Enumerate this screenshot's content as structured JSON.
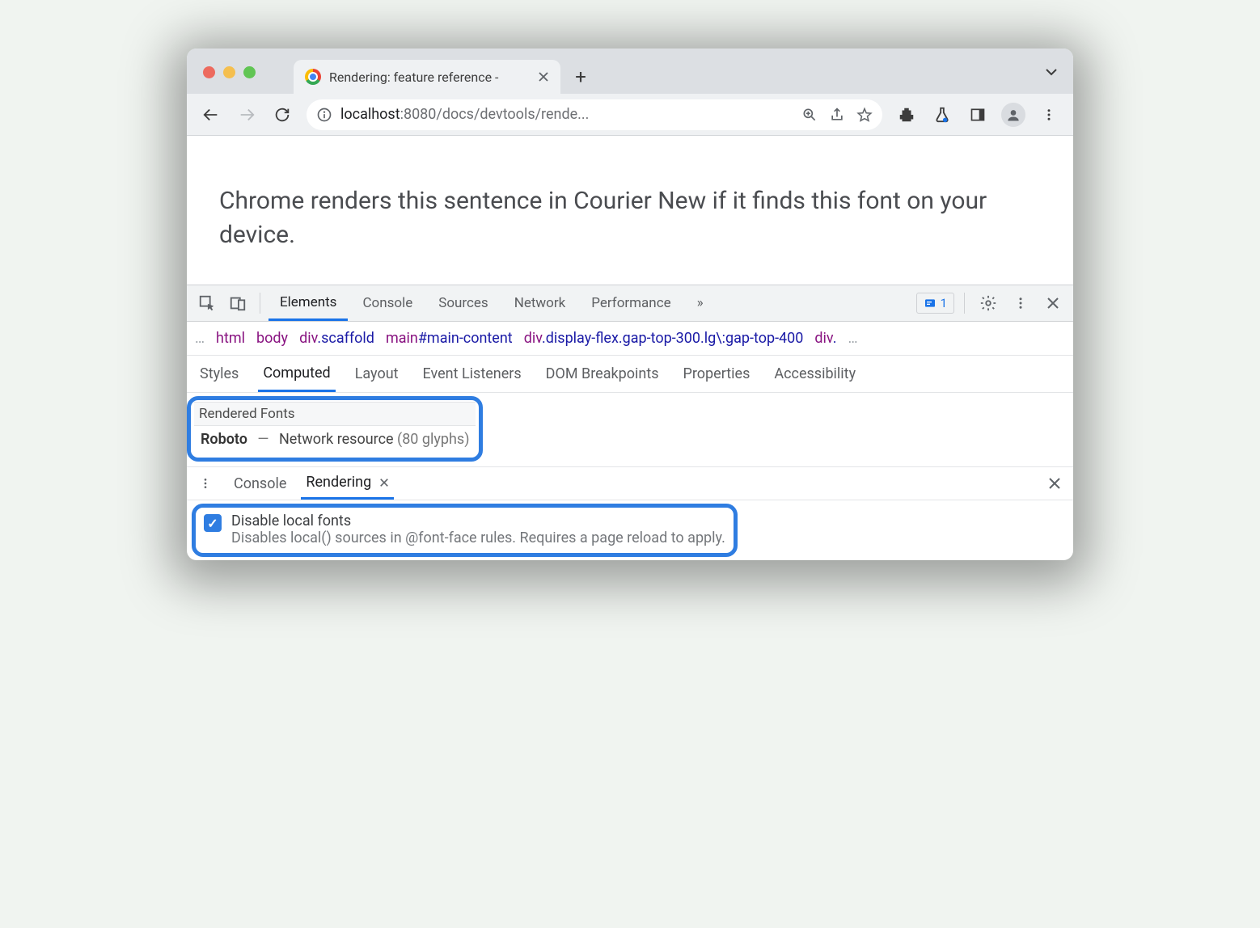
{
  "window": {
    "tab_title": "Rendering: feature reference -",
    "url_host": "localhost",
    "url_rest": ":8080/docs/devtools/rende..."
  },
  "content": {
    "text": "Chrome renders this sentence in Courier New if it finds this font on your device."
  },
  "devtools": {
    "main_tabs": [
      "Elements",
      "Console",
      "Sources",
      "Network",
      "Performance"
    ],
    "overflow_glyph": "»",
    "issue_count": "1",
    "breadcrumb": [
      {
        "tag": "html",
        "cls": ""
      },
      {
        "tag": "body",
        "cls": ""
      },
      {
        "tag": "div",
        "cls": ".scaffold"
      },
      {
        "tag": "main",
        "cls": "#main-content"
      },
      {
        "tag": "div",
        "cls": ".display-flex.gap-top-300.lg\\:gap-top-400"
      },
      {
        "tag": "div",
        "cls": "."
      }
    ],
    "sidebar_tabs": [
      "Styles",
      "Computed",
      "Layout",
      "Event Listeners",
      "DOM Breakpoints",
      "Properties",
      "Accessibility"
    ],
    "sidebar_active_index": 1,
    "rendered_fonts": {
      "header": "Rendered Fonts",
      "name": "Roboto",
      "dash": "—",
      "source": "Network resource",
      "glyphs": "(80 glyphs)"
    },
    "drawer": {
      "tabs": [
        "Console",
        "Rendering"
      ],
      "active_index": 1,
      "option_title": "Disable local fonts",
      "option_desc": "Disables local() sources in @font-face rules. Requires a page reload to apply."
    }
  }
}
